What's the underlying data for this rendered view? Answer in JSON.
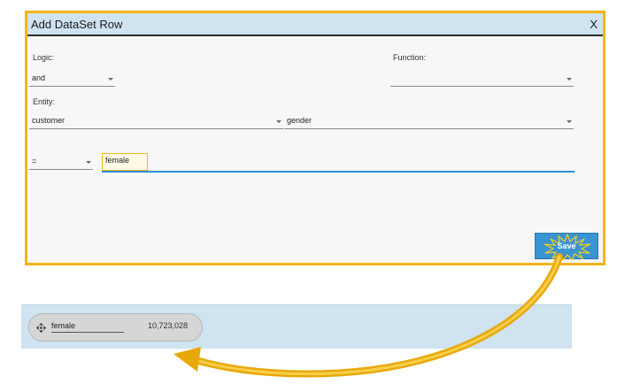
{
  "dialog": {
    "title": "Add DataSet Row",
    "close_label": "X",
    "logic": {
      "label": "Logic:",
      "value": "and"
    },
    "function": {
      "label": "Function:",
      "value": ""
    },
    "entity": {
      "label": "Entity:",
      "value": "customer",
      "attribute": "gender"
    },
    "condition": {
      "operator": "=",
      "value": "female"
    },
    "save_label": "Save"
  },
  "result": {
    "label": "female",
    "count": "10,723,028"
  },
  "colors": {
    "highlight": "#f3b51a",
    "header": "#cfe3f1",
    "save_button": "#3a93d3",
    "input_underline": "#2d8fd5"
  }
}
